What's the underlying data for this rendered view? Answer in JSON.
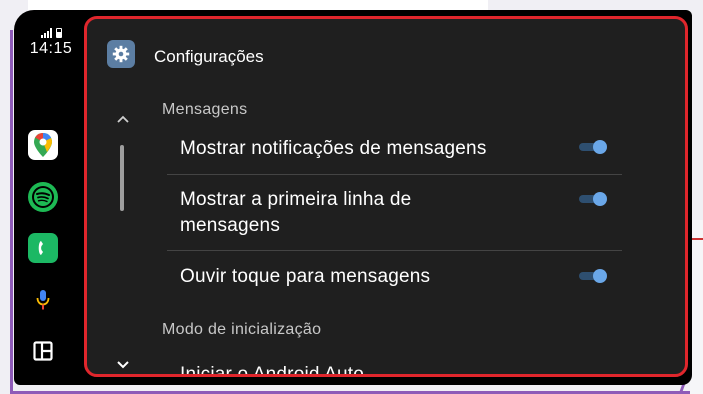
{
  "status": {
    "time": "14:15"
  },
  "rail": {
    "apps": [
      {
        "name": "Google Maps"
      },
      {
        "name": "Spotify"
      },
      {
        "name": "Phone"
      }
    ]
  },
  "header": {
    "title": "Configurações"
  },
  "sections": [
    {
      "title": "Mensagens",
      "items": [
        {
          "label": "Mostrar notificações de mensagens",
          "toggle_on": true
        },
        {
          "label": "Mostrar a primeira linha de mensagens",
          "toggle_on": true
        },
        {
          "label": "Ouvir toque para mensagens",
          "toggle_on": true
        }
      ]
    },
    {
      "title": "Modo de inicialização",
      "items": [
        {
          "label": "Iniciar o Android Auto"
        }
      ]
    }
  ],
  "colors": {
    "highlight_border": "#e0262c",
    "toggle_knob": "#6aa7e8",
    "panel_bg": "#1f1f1f"
  }
}
